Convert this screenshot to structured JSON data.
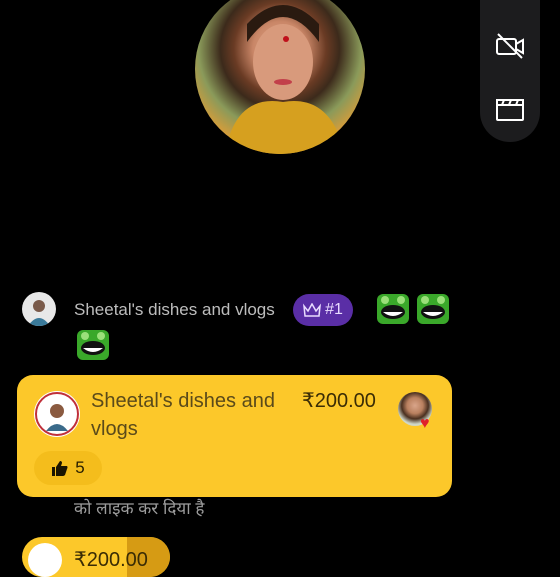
{
  "host": {
    "avatar": "host-profile-photo"
  },
  "side_panel": {
    "icons": [
      "video-off-icon",
      "clapperboard-icon"
    ]
  },
  "chat": {
    "username": "Sheetal's dishes and vlogs",
    "rank_label": "#1",
    "rank_icon": "crown-icon",
    "emojis": [
      "laughing-frog-icon",
      "laughing-frog-icon",
      "laughing-frog-icon"
    ]
  },
  "gift_card": {
    "sender_name": "Sheetal's dishes and vlogs",
    "amount": "₹200.00",
    "like_count": "5",
    "background": "#fcc82a"
  },
  "system_message": "को लाइक कर दिया है",
  "bottom_card": {
    "amount": "₹200.00"
  }
}
